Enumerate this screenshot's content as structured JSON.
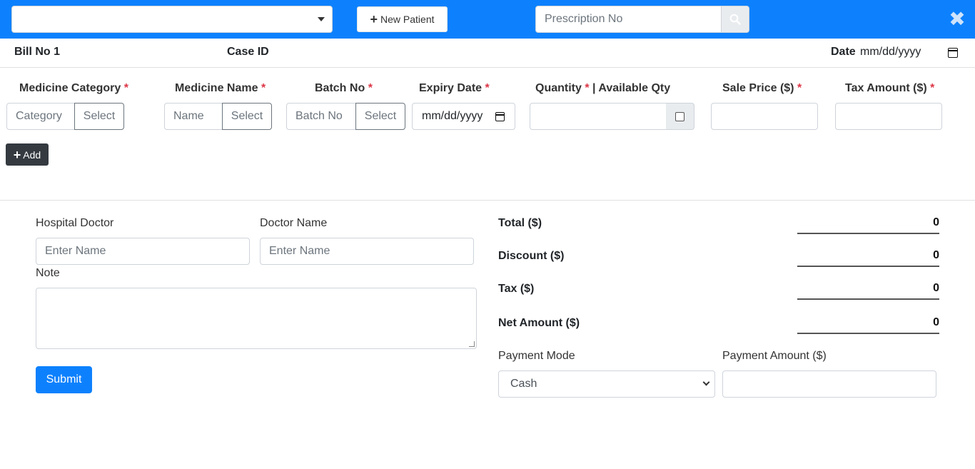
{
  "header": {
    "patient_select_value": "",
    "new_patient_label": "New Patient",
    "prescription_placeholder": "Prescription No"
  },
  "bill_info": {
    "bill_no_label": "Bill No 1",
    "case_id_label": "Case ID",
    "date_label": "Date",
    "date_value": "mm/dd/yyyy"
  },
  "medicine_row": {
    "labels": {
      "category": "Medicine Category",
      "name": "Medicine Name",
      "batch": "Batch No",
      "expiry": "Expiry Date",
      "quantity": "Quantity",
      "available_qty": " | Available Qty",
      "sale_price": "Sale Price ($)",
      "tax_amount": "Tax Amount ($)"
    },
    "required_mark": "*",
    "category_placeholder": "Category",
    "name_placeholder": "Name",
    "batch_placeholder": "Batch No",
    "select_label": "Select",
    "expiry_value": "mm/dd/yyyy",
    "add_label": "Add"
  },
  "doctor": {
    "hospital_doctor_label": "Hospital Doctor",
    "hospital_doctor_placeholder": "Enter Name",
    "doctor_name_label": "Doctor Name",
    "doctor_name_placeholder": "Enter Name",
    "note_label": "Note",
    "submit_label": "Submit"
  },
  "summary": {
    "total_label": "Total ($)",
    "total_value": "0",
    "discount_label": "Discount ($)",
    "discount_value": "0",
    "tax_label": "Tax ($)",
    "tax_value": "0",
    "net_label": "Net Amount ($)",
    "net_value": "0",
    "payment_mode_label": "Payment Mode",
    "payment_mode_value": "Cash",
    "payment_amount_label": "Payment Amount ($)"
  },
  "colors": {
    "topbar": "#0d81fd",
    "primary_button": "#0d81fd",
    "dark_button": "#343a40",
    "required": "#dc3545"
  }
}
